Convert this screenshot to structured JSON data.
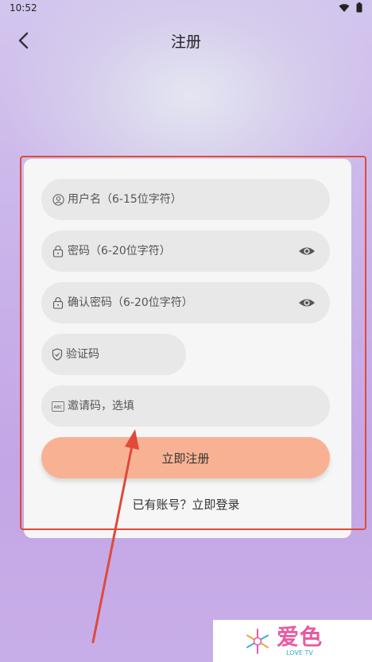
{
  "status": {
    "time": "10:52"
  },
  "header": {
    "title": "注册"
  },
  "form": {
    "username_placeholder": "用户名（6-15位字符）",
    "password_placeholder": "密码（6-20位字符）",
    "confirm_placeholder": "确认密码（6-20位字符）",
    "code_placeholder": "验证码",
    "invite_placeholder": "邀请码，选填",
    "register_label": "立即注册",
    "login_prompt": "已有账号？立即登录"
  },
  "watermark": {
    "cn": "爱色",
    "en": "LOVE TV"
  },
  "colors": {
    "accent_button": "#f8b293",
    "annotation_red": "#e04a3a",
    "watermark_pink": "#e95aa0"
  },
  "icons": [
    "wifi-icon",
    "battery-icon",
    "back-arrow-icon",
    "user-icon",
    "lock-icon",
    "eye-icon",
    "shield-icon",
    "abc-icon"
  ]
}
